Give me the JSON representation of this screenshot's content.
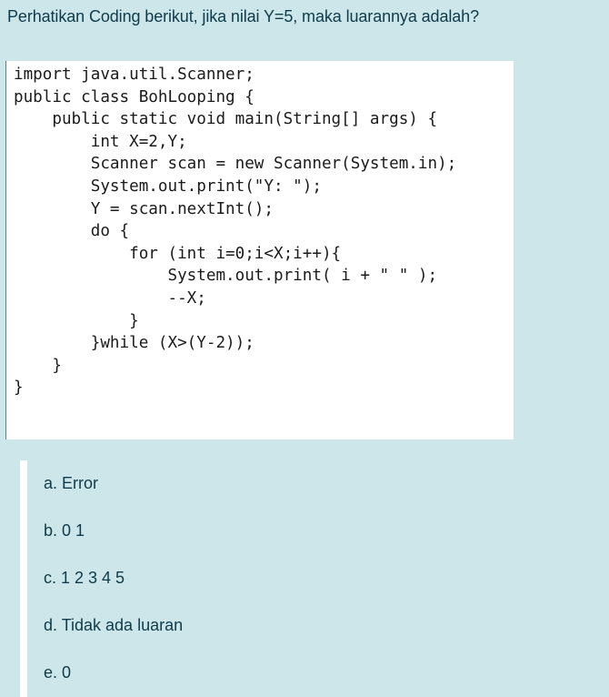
{
  "question": {
    "text": "Perhatikan Coding berikut, jika nilai Y=5, maka luarannya adalah?"
  },
  "code": {
    "lines": [
      "import java.util.Scanner;",
      "public class BohLooping {",
      "    public static void main(String[] args) {",
      "        int X=2,Y;",
      "        Scanner scan = new Scanner(System.in);",
      "        System.out.print(\"Y: \");",
      "        Y = scan.nextInt();",
      "        do {",
      "            for (int i=0;i<X;i++){",
      "                System.out.print( i + \" \" );",
      "                --X;",
      "            }",
      "        }while (X>(Y-2));",
      "    }",
      "}"
    ]
  },
  "options": [
    {
      "label": "a. Error"
    },
    {
      "label": "b. 0 1"
    },
    {
      "label": "c. 1 2 3 4 5"
    },
    {
      "label": "d. Tidak ada luaran"
    },
    {
      "label": "e. 0"
    }
  ]
}
